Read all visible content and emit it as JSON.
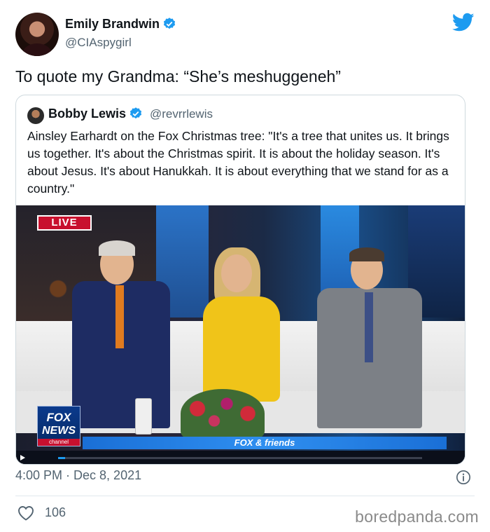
{
  "author": {
    "name": "Emily Brandwin",
    "handle": "@CIAspygirl",
    "verified": true
  },
  "tweet": {
    "text": "To quote my Grandma: “She’s meshuggeneh”",
    "timestamp": "4:00 PM · Dec 8, 2021",
    "likes": "106"
  },
  "quoted_tweet": {
    "name": "Bobby Lewis",
    "handle": "@revrrlewis",
    "verified": true,
    "text": "Ainsley Earhardt on the Fox Christmas tree: \"It's a tree that unites us. It brings us together. It's about the Christmas spirit. It is about the holiday season. It's about Jesus. It's about Hanukkah. It is about everything that we stand for as a country.\""
  },
  "video": {
    "live_label": "LIVE",
    "network_line1": "FOX",
    "network_line2": "NEWS",
    "network_line3": "channel",
    "show_name": "FOX & friends",
    "progress": 0.02
  },
  "icons": {
    "twitter": "twitter-bird-icon",
    "verified": "verified-badge-icon",
    "info": "info-icon",
    "like": "heart-icon",
    "play": "play-icon"
  },
  "colors": {
    "accent": "#1d9bf0",
    "text": "#0f1419",
    "muted": "#536471",
    "live_red": "#c8102e"
  },
  "watermark": "boredpanda.com"
}
